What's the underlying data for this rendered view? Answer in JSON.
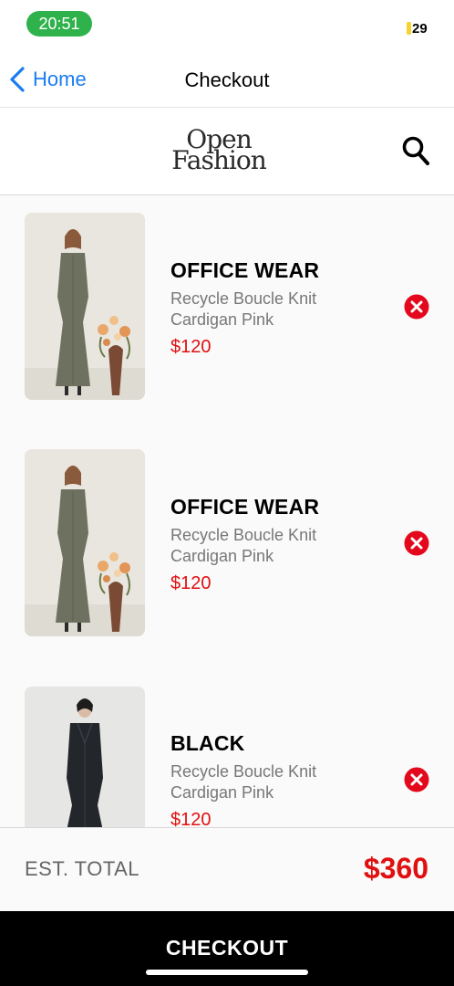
{
  "status_bar": {
    "time": "20:51",
    "battery": "29"
  },
  "nav": {
    "back_label": "Home",
    "title": "Checkout"
  },
  "brand": {
    "logo_line1": "Open",
    "logo_line2": "Fashion"
  },
  "cart": {
    "items": [
      {
        "name": "OFFICE WEAR",
        "description": "Recycle Boucle Knit Cardigan Pink",
        "price": "$120"
      },
      {
        "name": "OFFICE WEAR",
        "description": "Recycle Boucle Knit Cardigan Pink",
        "price": "$120"
      },
      {
        "name": "BLACK",
        "description": "Recycle Boucle Knit Cardigan Pink",
        "price": "$120"
      }
    ]
  },
  "total": {
    "label": "EST. TOTAL",
    "value": "$360"
  },
  "checkout": {
    "label": "CHECKOUT"
  },
  "colors": {
    "accent_red": "#e01010",
    "link_blue": "#1a7cf3",
    "status_green": "#2fb24c"
  }
}
